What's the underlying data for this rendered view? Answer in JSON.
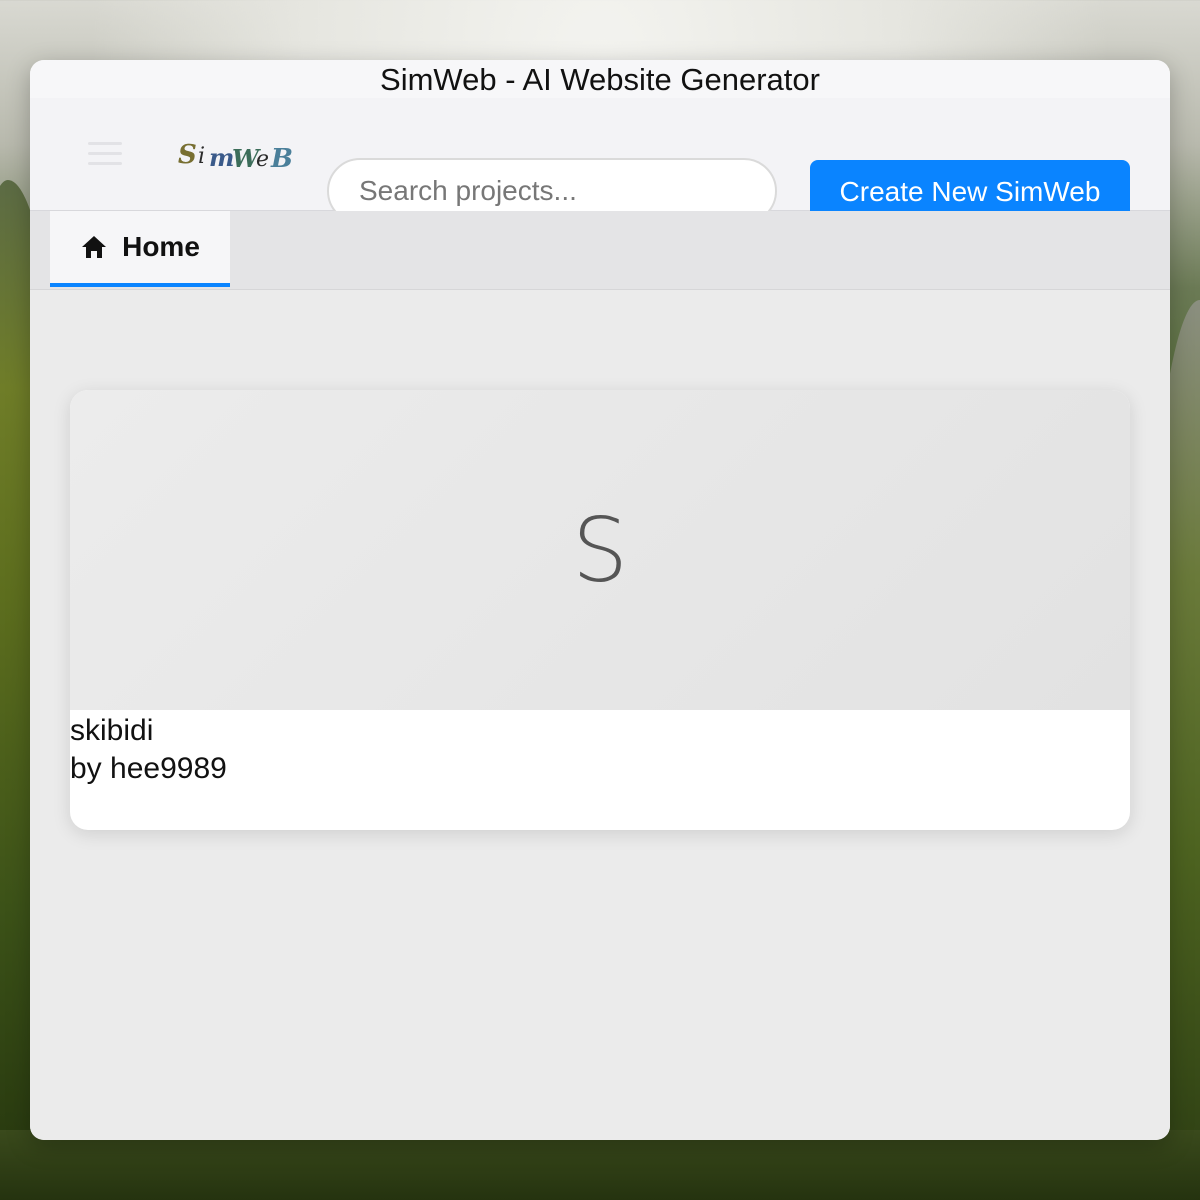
{
  "window": {
    "title": "SimWeb - AI Website Generator"
  },
  "header": {
    "logo_text": "SimWeB",
    "search_placeholder": "Search projects...",
    "create_button_label": "Create New SimWeb"
  },
  "tabs": [
    {
      "label": "Home",
      "icon": "home-icon",
      "active": true
    }
  ],
  "projects": [
    {
      "initial": "S",
      "title": "skibidi",
      "author": "by hee9989"
    }
  ],
  "colors": {
    "accent": "#0a84ff"
  }
}
